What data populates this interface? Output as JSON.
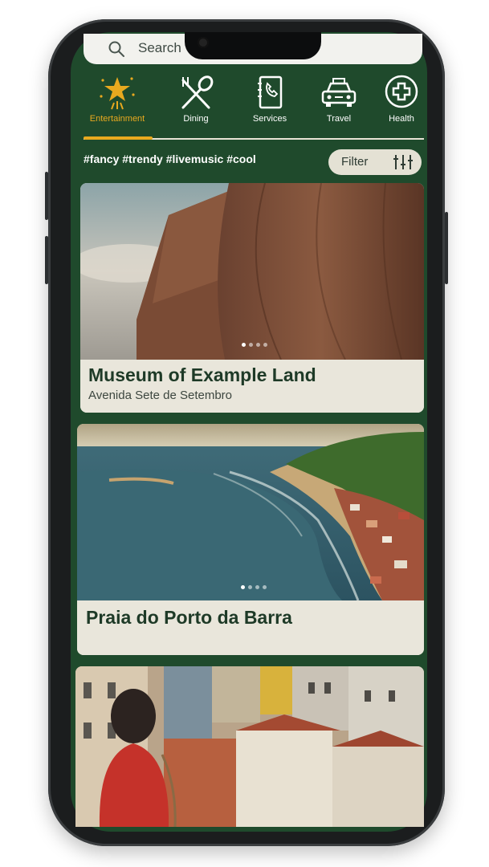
{
  "search": {
    "placeholder": "Search"
  },
  "categories": [
    {
      "label": "Entertainment",
      "icon": "star-sparkle-icon",
      "active": true
    },
    {
      "label": "Dining",
      "icon": "fork-spoon-icon",
      "active": false
    },
    {
      "label": "Services",
      "icon": "phone-book-icon",
      "active": false
    },
    {
      "label": "Travel",
      "icon": "car-icon",
      "active": false
    },
    {
      "label": "Health",
      "icon": "plus-circle-icon",
      "active": false
    }
  ],
  "tags": "#fancy #trendy #livemusic #cool",
  "filter": {
    "label": "Filter",
    "icon": "sliders-icon"
  },
  "cards": [
    {
      "title": "Museum of Example Land",
      "subtitle": "Avenida Sete de Setembro",
      "carousel_count": 4,
      "carousel_active": 1
    },
    {
      "title": "Praia do Porto da Barra",
      "subtitle": "",
      "carousel_count": 4,
      "carousel_active": 1
    },
    {
      "title": "",
      "subtitle": ""
    }
  ],
  "colors": {
    "background": "#1f4a2c",
    "accent": "#e8a91f",
    "card": "#e9e6db",
    "title": "#1e3a27"
  }
}
